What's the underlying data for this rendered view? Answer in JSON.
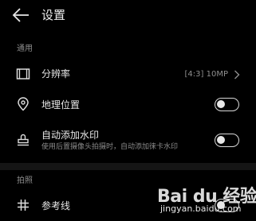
{
  "header": {
    "back_icon": "arrow-left-icon",
    "title": "设置"
  },
  "sections": {
    "general": {
      "label": "通用",
      "resolution": {
        "icon": "film-frame-icon",
        "label": "分辨率",
        "value": "[4:3] 10MP",
        "chevron_icon": "chevron-right-icon"
      },
      "location": {
        "icon": "location-pin-icon",
        "label": "地理位置",
        "toggle_on": false
      },
      "watermark": {
        "icon": "stamp-icon",
        "label": "自动添加水印",
        "description": "使用后置摄像头拍摄时，自动添加徕卡水印",
        "toggle_on": false
      }
    },
    "shooting": {
      "label": "拍照",
      "gridlines": {
        "icon": "grid-hash-icon",
        "label": "参考线",
        "toggle_on": false
      }
    }
  },
  "overlay": {
    "logo_text": "Bai du 经验",
    "url": "jingyan.baidu.com"
  },
  "colors": {
    "background": "#000000",
    "divider": "#151515",
    "text_primary": "#e6e6e6",
    "text_secondary": "#8a8a8a"
  }
}
